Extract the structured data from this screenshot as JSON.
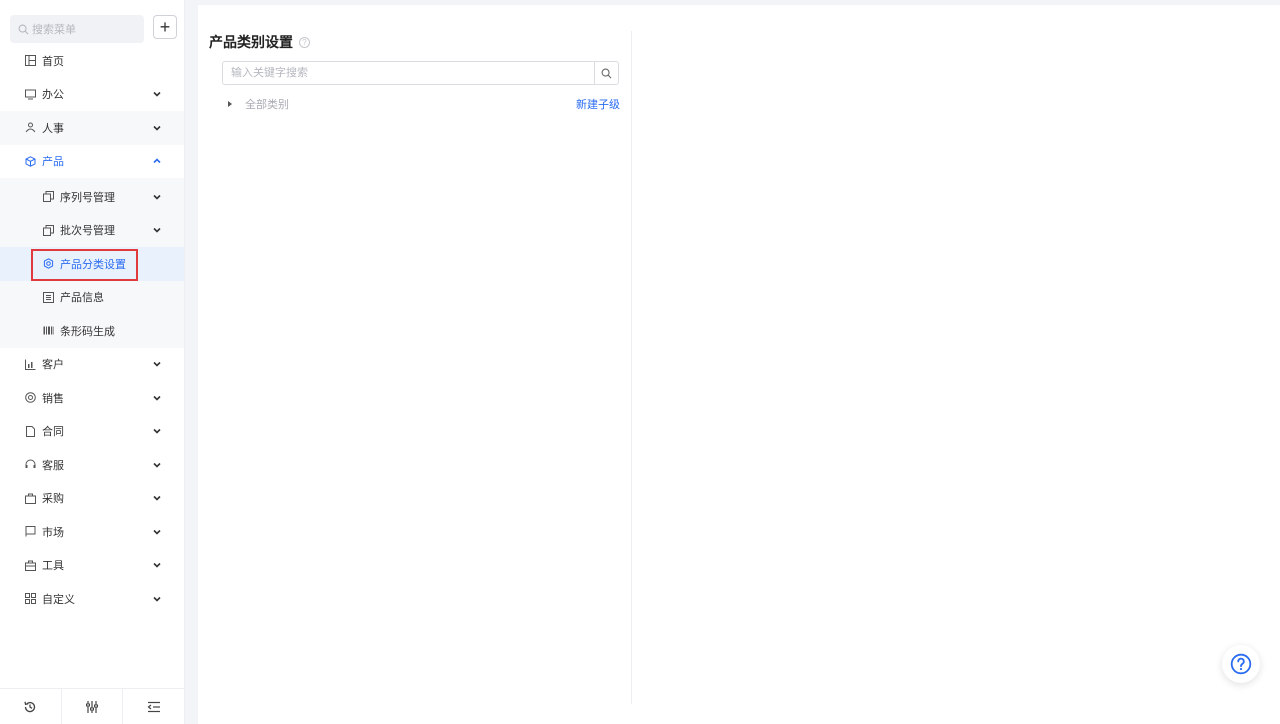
{
  "sidebar": {
    "search_placeholder": "搜索菜单",
    "add_label": "+",
    "items": [
      {
        "label": "首页",
        "icon": "grid-icon"
      },
      {
        "label": "办公",
        "icon": "monitor-icon"
      },
      {
        "label": "人事",
        "icon": "people-icon"
      },
      {
        "label": "产品",
        "icon": "cube-icon"
      },
      {
        "label": "客户",
        "icon": "chart-icon"
      },
      {
        "label": "销售",
        "icon": "coin-icon"
      },
      {
        "label": "合同",
        "icon": "document-icon"
      },
      {
        "label": "客服",
        "icon": "headset-icon"
      },
      {
        "label": "采购",
        "icon": "bag-icon"
      },
      {
        "label": "市场",
        "icon": "flag-icon"
      },
      {
        "label": "工具",
        "icon": "toolbox-icon"
      },
      {
        "label": "自定义",
        "icon": "apps-icon"
      }
    ],
    "product_sub": [
      {
        "label": "序列号管理",
        "icon": "copy-icon"
      },
      {
        "label": "批次号管理",
        "icon": "copy-icon"
      },
      {
        "label": "产品分类设置",
        "icon": "gear-icon"
      },
      {
        "label": "产品信息",
        "icon": "list-icon"
      },
      {
        "label": "条形码生成",
        "icon": "barcode-icon"
      }
    ],
    "bottom_icons": [
      "history-icon",
      "sliders-icon",
      "collapse-menu-icon"
    ]
  },
  "main": {
    "title": "产品类别设置",
    "search_placeholder": "输入关键字搜索",
    "tree": {
      "root_label": "全部类别",
      "new_child_label": "新建子级"
    }
  },
  "colors": {
    "accent": "#2b6cf0",
    "highlight_border": "#e0393e",
    "selected_bg": "#e9f1fd"
  }
}
